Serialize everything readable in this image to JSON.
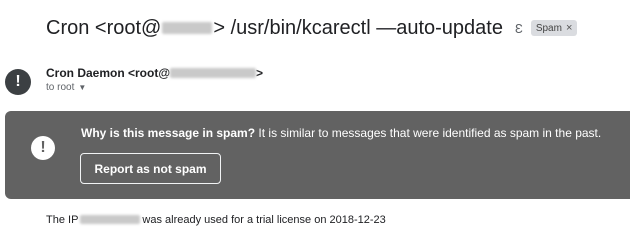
{
  "subject": {
    "prefix": "Cron <root@",
    "suffix": "> /usr/bin/kcarectl —auto-update",
    "important_glyph": "Ɛ",
    "label": "Spam",
    "label_close": "×"
  },
  "sender": {
    "avatar_icon": "!",
    "name_prefix": "Cron Daemon <root@",
    "name_suffix": ">",
    "recipient": "to root",
    "recipient_caret": "▼"
  },
  "banner": {
    "icon": "!",
    "question": "Why is this message in spam?",
    "explanation": " It is similar to messages that were identified as spam in the past.",
    "button_label": "Report as not spam"
  },
  "body": {
    "text_prefix": "The IP",
    "text_suffix": "was already used for a trial license on 2018-12-23"
  },
  "colors": {
    "banner_bg": "#626262",
    "label_bg": "#dadce0",
    "text": "#202124",
    "muted": "#5f6368"
  }
}
